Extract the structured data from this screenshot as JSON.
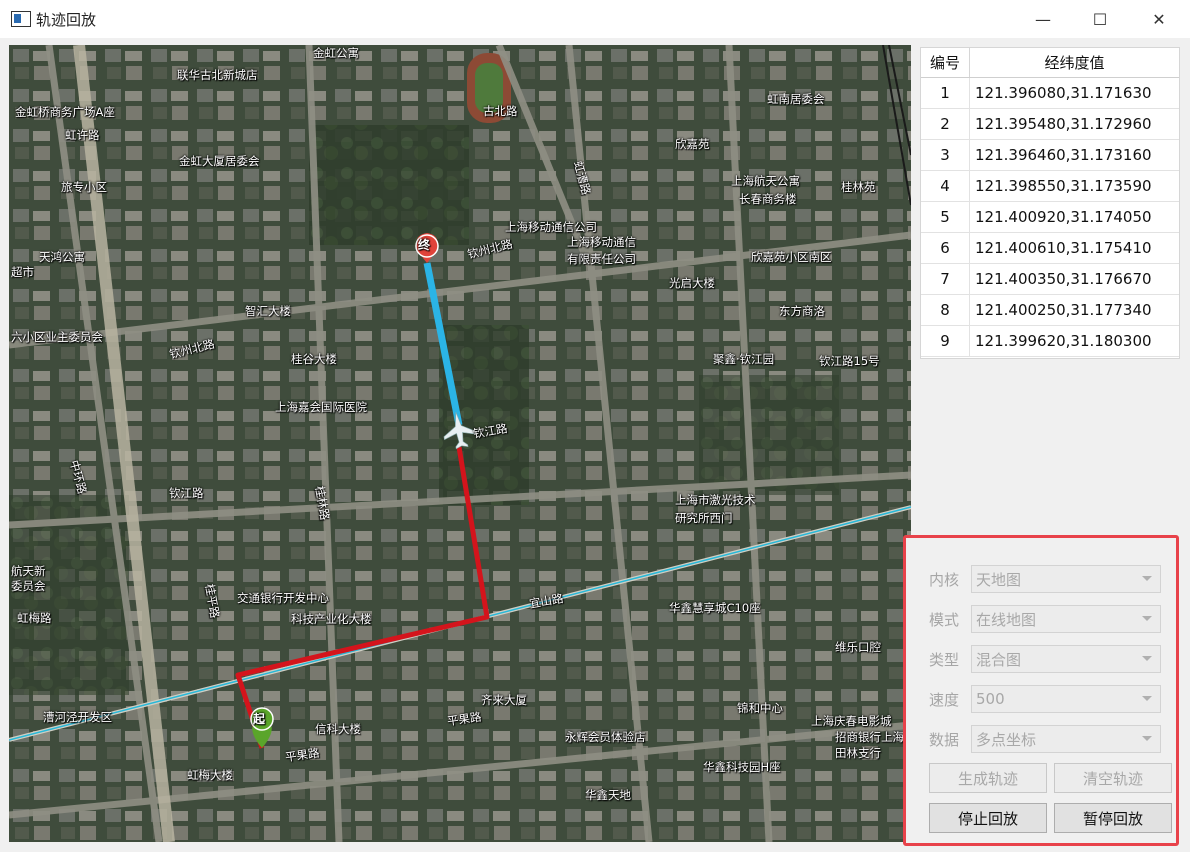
{
  "window": {
    "title": "轨迹回放",
    "minimize_glyph": "—",
    "maximize_glyph": "☐",
    "close_glyph": "✕"
  },
  "map": {
    "start_marker": "起",
    "end_marker": "终",
    "labels": [
      "金虹公寓",
      "联华古北新城店",
      "古北路",
      "虹南居委会",
      "金虹桥商务广场A座",
      "虹许路",
      "金虹大厦居委会",
      "旅专小区",
      "欣嘉苑",
      "上海航天公寓",
      "桂林苑",
      "长春商务楼",
      "上海移动通信公司",
      "上海移动通信",
      "有限责任公司",
      "钦州北路",
      "天鸿公寓",
      "超市",
      "欣嘉苑小区南区",
      "光启大楼",
      "智汇大楼",
      "东方商洛",
      "六小区业主委员会",
      "钦州北路",
      "桂谷大楼",
      "聚鑫·钦江园",
      "钦江路15号",
      "上海嘉会国际医院",
      "钦江路",
      "钦江路",
      "中环路",
      "上海市激光技术",
      "研究所西门",
      "航天新",
      "委员会",
      "虹梅路",
      "交通银行开发中心",
      "科技产业化大楼",
      "华鑫慧享城C10座",
      "宜山路",
      "维乐口腔",
      "漕河泾开发区",
      "齐来大厦",
      "锦和中心",
      "上海庆春电影城",
      "信科大楼",
      "永辉会员体验店",
      "招商银行上海",
      "田林支行",
      "平果路",
      "华鑫科技园H座",
      "虹梅大楼",
      "华鑫天地",
      "平果路",
      "桂平路",
      "桂林路",
      "虹漕路"
    ]
  },
  "table": {
    "headers": [
      "编号",
      "经纬度值"
    ],
    "rows": [
      [
        "1",
        "121.396080,31.171630"
      ],
      [
        "2",
        "121.395480,31.172960"
      ],
      [
        "3",
        "121.396460,31.173160"
      ],
      [
        "4",
        "121.398550,31.173590"
      ],
      [
        "5",
        "121.400920,31.174050"
      ],
      [
        "6",
        "121.400610,31.175410"
      ],
      [
        "7",
        "121.400350,31.176670"
      ],
      [
        "8",
        "121.400250,31.177340"
      ],
      [
        "9",
        "121.399620,31.180300"
      ]
    ]
  },
  "controls": {
    "kernel": {
      "label": "内核",
      "value": "天地图"
    },
    "mode": {
      "label": "模式",
      "value": "在线地图"
    },
    "type": {
      "label": "类型",
      "value": "混合图"
    },
    "speed": {
      "label": "速度",
      "value": "500"
    },
    "data": {
      "label": "数据",
      "value": "多点坐标"
    },
    "generate_button": "生成轨迹",
    "clear_button": "清空轨迹",
    "stop_button": "停止回放",
    "pause_button": "暂停回放"
  },
  "colors": {
    "track_played": "#d4141c",
    "track_pending": "#2bb4e6",
    "highlight_border": "#e8424a"
  }
}
